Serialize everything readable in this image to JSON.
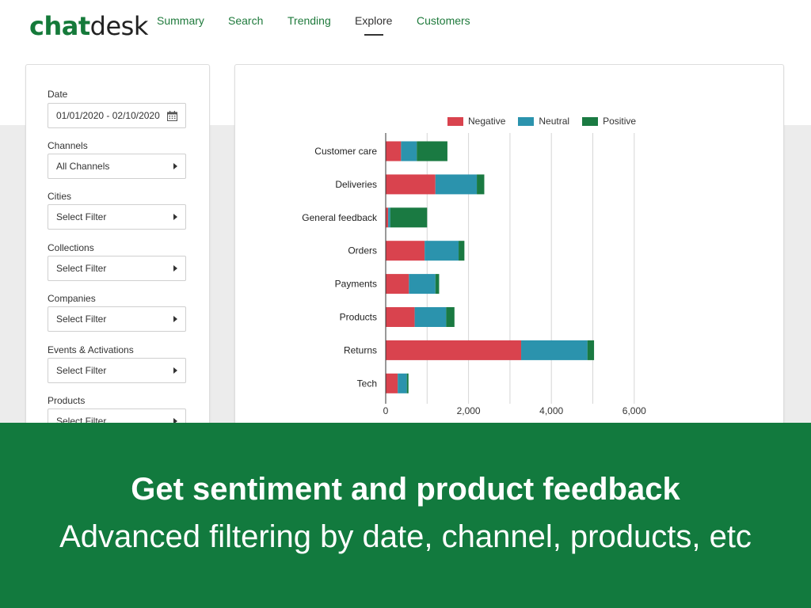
{
  "brand": {
    "logo_part1": "chat",
    "logo_part2": "desk"
  },
  "nav": {
    "items": [
      {
        "label": "Summary",
        "active": false
      },
      {
        "label": "Search",
        "active": false
      },
      {
        "label": "Trending",
        "active": false
      },
      {
        "label": "Explore",
        "active": true
      },
      {
        "label": "Customers",
        "active": false
      }
    ]
  },
  "filters": [
    {
      "label": "Date",
      "value": "01/01/2020 - 02/10/2020",
      "icon": "calendar-icon"
    },
    {
      "label": "Channels",
      "value": "All Channels",
      "icon": "caret-right-icon"
    },
    {
      "label": "Cities",
      "value": "Select Filter",
      "icon": "caret-right-icon"
    },
    {
      "label": "Collections",
      "value": "Select Filter",
      "icon": "caret-right-icon"
    },
    {
      "label": "Companies",
      "value": "Select Filter",
      "icon": "caret-right-icon"
    },
    {
      "label": "Events & Activations",
      "value": "Select Filter",
      "icon": "caret-right-icon"
    },
    {
      "label": "Products",
      "value": "Select Filter",
      "icon": "caret-right-icon"
    }
  ],
  "chart_data": {
    "type": "bar",
    "orientation": "horizontal",
    "stacked": true,
    "categories": [
      "Customer care",
      "Deliveries",
      "General feedback",
      "Orders",
      "Payments",
      "Products",
      "Returns",
      "Tech"
    ],
    "series": [
      {
        "name": "Negative",
        "color": "#d9434e",
        "values": [
          370,
          1200,
          60,
          940,
          560,
          700,
          3270,
          290
        ]
      },
      {
        "name": "Neutral",
        "color": "#2b93ad",
        "values": [
          380,
          1000,
          50,
          820,
          640,
          760,
          1600,
          220
        ]
      },
      {
        "name": "Positive",
        "color": "#1a7a42",
        "values": [
          740,
          180,
          890,
          140,
          90,
          200,
          160,
          40
        ]
      }
    ],
    "xticks": [
      "0",
      "2,000",
      "4,000",
      "6,000"
    ],
    "xlim": [
      0,
      6000
    ],
    "legend_position": "top",
    "grid": true
  },
  "banner": {
    "title": "Get sentiment and product feedback",
    "subtitle": "Advanced filtering by date, channel, products, etc"
  },
  "colors": {
    "brand_green": "#127a3e",
    "nav_green": "#1f7a3c"
  }
}
